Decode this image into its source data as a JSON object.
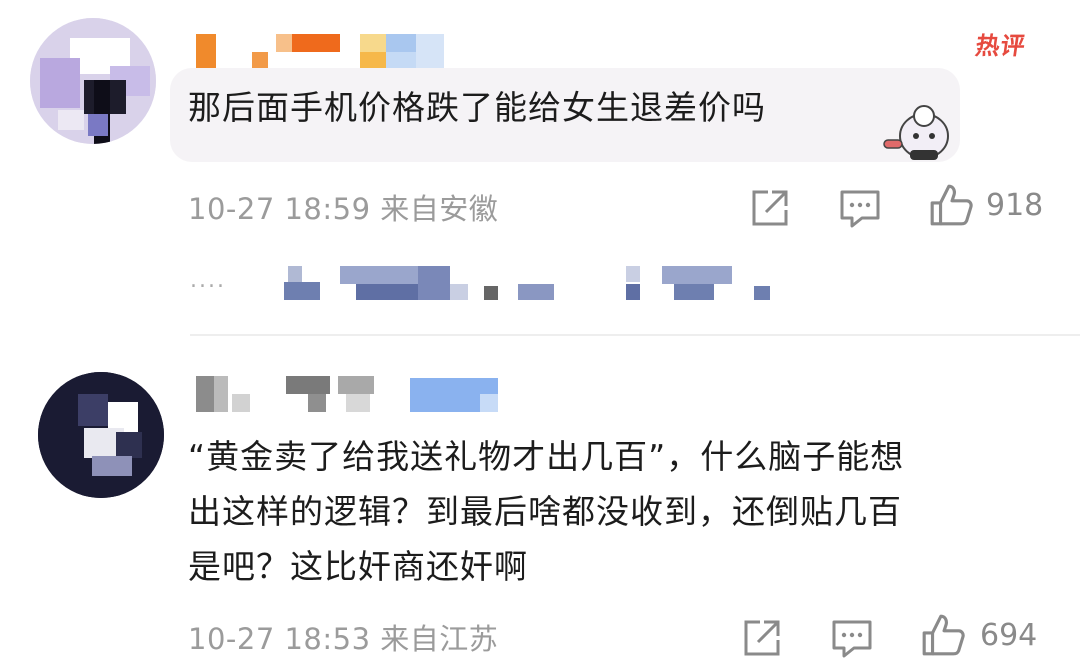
{
  "comments": [
    {
      "text": "那后面手机价格跌了能给女生退差价吗",
      "time": "10-27 18:59",
      "location": "来自安徽",
      "likes": "918",
      "badge": "热评"
    },
    {
      "lines": [
        "“黄金卖了给我送礼物才出几百”，什么脑子能想",
        "出这样的逻辑？到最后啥都没收到，还倒贴几百",
        "是吧？这比奸商还奸啊"
      ],
      "time": "10-27 18:53",
      "location": "来自江苏",
      "likes": "694"
    }
  ],
  "reply_more": "....",
  "colors": {
    "meta": "#9b9b9b",
    "bubble": "#f5f3f6",
    "hot_badge": "#e64a3f"
  },
  "icons": [
    "share-icon",
    "comment-icon",
    "like-icon"
  ]
}
